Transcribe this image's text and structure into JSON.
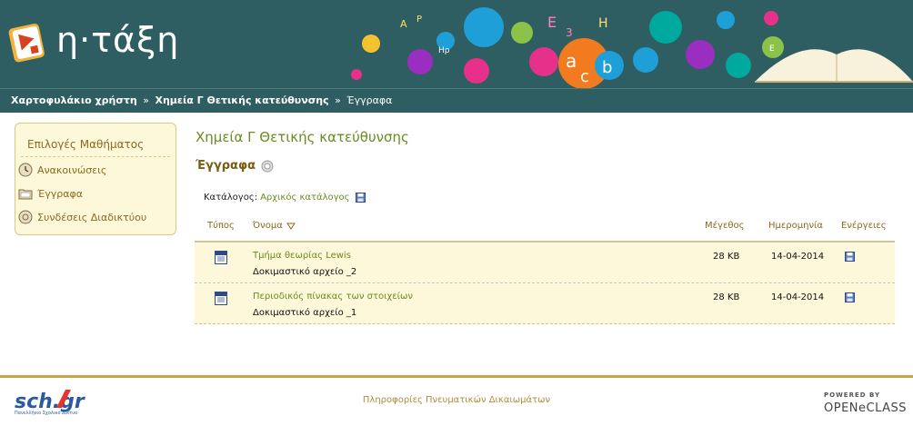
{
  "header": {
    "logo_text": "η·τάξη",
    "banner_letters": [
      "A",
      "P",
      "E",
      "3",
      "H",
      "a",
      "c",
      "b",
      "Hρ",
      "E"
    ]
  },
  "breadcrumb": {
    "items": [
      "Χαρτοφυλάκιο χρήστη",
      "Χημεία Γ Θετικής κατεύθυνσης"
    ],
    "current": "Έγγραφα",
    "separator": "»"
  },
  "sidebar": {
    "title": "Επιλογές Μαθήματος",
    "items": [
      {
        "label": "Ανακοινώσεις",
        "icon": "clock-icon"
      },
      {
        "label": "Έγγραφα",
        "icon": "folder-icon"
      },
      {
        "label": "Συνδέσεις Διαδικτύου",
        "icon": "links-icon"
      }
    ]
  },
  "main": {
    "course_title": "Χημεία Γ Θετικής κατεύθυνσης",
    "section_title": "Έγγραφα",
    "catalog_label": "Κατάλογος:",
    "catalog_value": "Αρχικός κατάλογος"
  },
  "table": {
    "headers": {
      "type": "Τύπος",
      "name": "Όνομα",
      "size": "Μέγεθος",
      "date": "Ημερομηνία",
      "actions": "Ενέργειες"
    },
    "rows": [
      {
        "name": "Τμήμα θεωρίας Lewis",
        "description": "Δοκιμαστικό αρχείο _2",
        "size": "28 KB",
        "date": "14-04-2014",
        "type_icon": "word-document-icon"
      },
      {
        "name": "Περιοδικός πίνακας των στοιχείων",
        "description": "Δοκιμαστικό αρχείο _1",
        "size": "28 KB",
        "date": "14-04-2014",
        "type_icon": "word-document-icon"
      }
    ]
  },
  "footer": {
    "sch_logo": "sch.gr",
    "sch_tagline": "Πανελλήνιο Σχολικό Δίκτυο",
    "copyright_link": "Πληροφορίες Πνευματικών Δικαιωμάτων",
    "powered_by": "POWERED BY",
    "openclass": "OPENeCLASS"
  },
  "colors": {
    "header_bg": "#2f5e62",
    "accent_green": "#6a8b22",
    "accent_brown": "#8a6a1f",
    "row_bg": "#fdf8d9",
    "footer_line": "#caa24a"
  }
}
